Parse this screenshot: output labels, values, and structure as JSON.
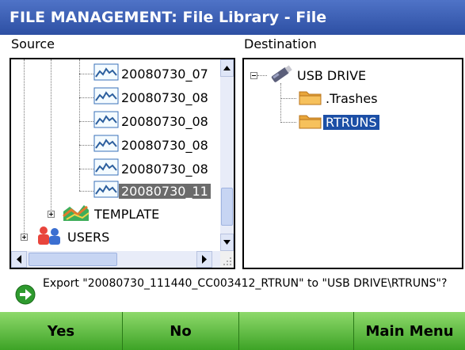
{
  "window": {
    "title": "FILE MANAGEMENT: File Library - File"
  },
  "source": {
    "label": "Source",
    "items": [
      {
        "label": "20080730_07",
        "selected": false
      },
      {
        "label": "20080730_08",
        "selected": false
      },
      {
        "label": "20080730_08",
        "selected": false
      },
      {
        "label": "20080730_08",
        "selected": false
      },
      {
        "label": "20080730_08",
        "selected": false
      },
      {
        "label": "20080730_11",
        "selected": true
      }
    ],
    "template_label": "TEMPLATE",
    "users_label": "USERS"
  },
  "destination": {
    "label": "Destination",
    "root_label": "USB DRIVE",
    "children": [
      {
        "label": ".Trashes",
        "selected": false
      },
      {
        "label": "RTRUNS",
        "selected": true
      }
    ]
  },
  "message": {
    "text": "Export \"20080730_111440_CC003412_RTRUN\" to \"USB DRIVE\\RTRUNS\"?"
  },
  "buttons": {
    "yes": "Yes",
    "no": "No",
    "blank": "",
    "main_menu": "Main Menu"
  },
  "colors": {
    "title_bar": "#2d4fa3",
    "selection_blue": "#1c4fa6",
    "selection_gray": "#6b6b6b",
    "button_green": "#3da326"
  }
}
